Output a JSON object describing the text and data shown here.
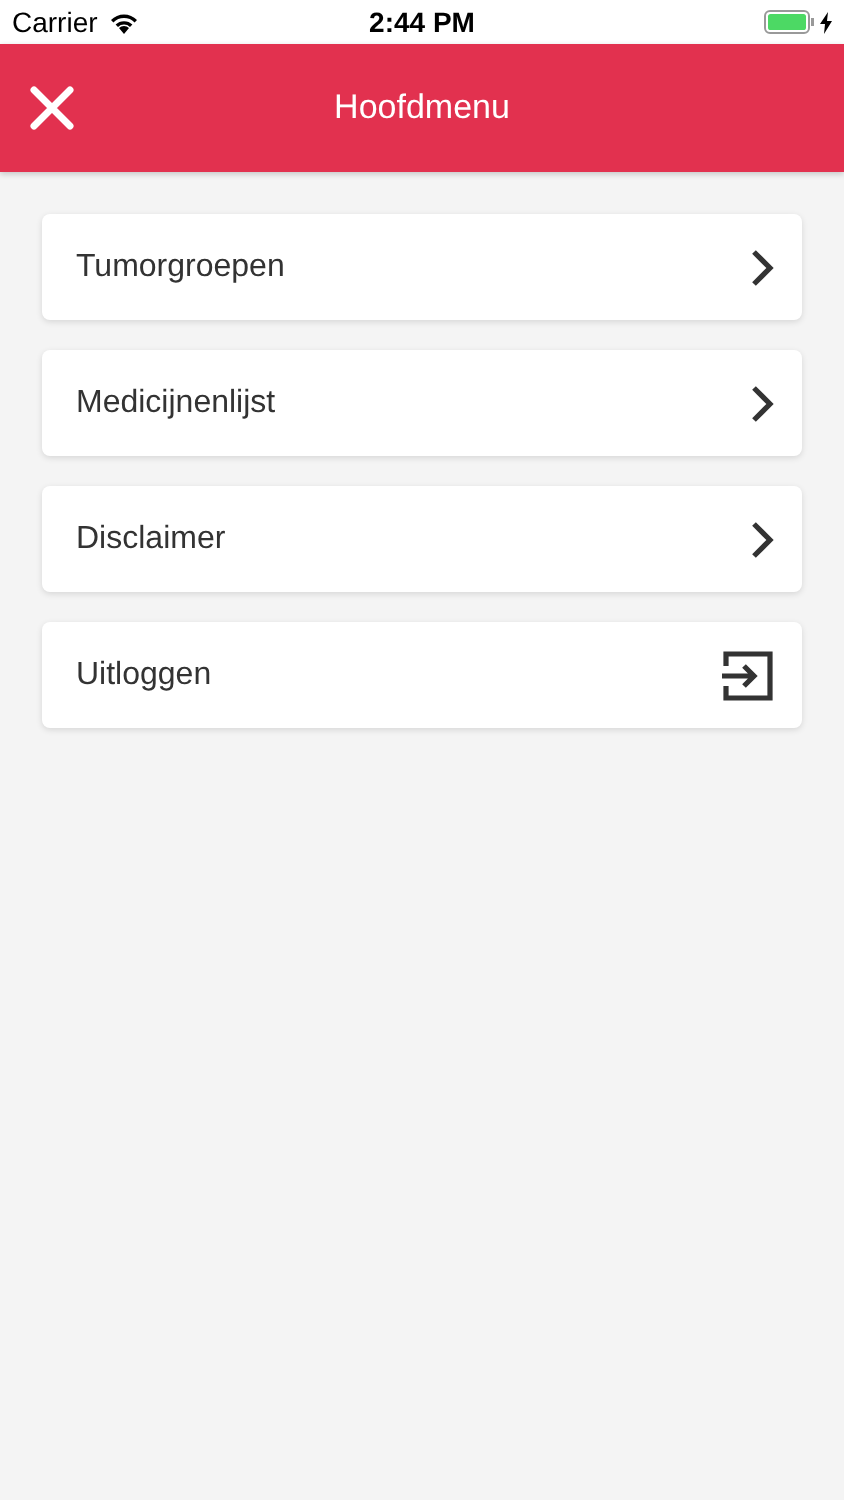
{
  "status_bar": {
    "carrier": "Carrier",
    "time": "2:44 PM"
  },
  "header": {
    "title": "Hoofdmenu"
  },
  "menu": [
    {
      "label": "Tumorgroepen",
      "kind": "link"
    },
    {
      "label": "Medicijnenlijst",
      "kind": "link"
    },
    {
      "label": "Disclaimer",
      "kind": "link"
    },
    {
      "label": "Uitloggen",
      "kind": "logout"
    }
  ]
}
